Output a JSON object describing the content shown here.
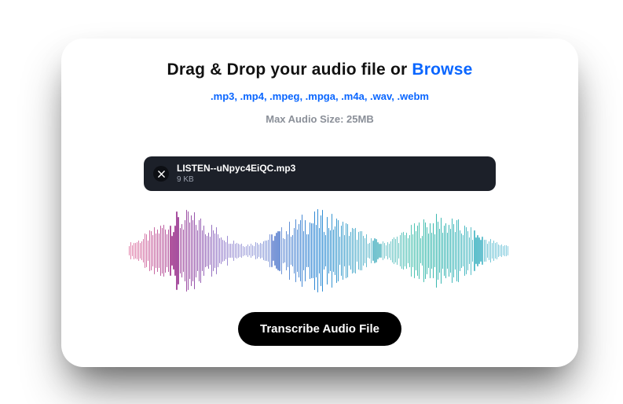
{
  "heading": {
    "prefix": "Drag & Drop your audio file or ",
    "browse": "Browse"
  },
  "formats_label": ".mp3, .mp4, .mpeg, .mpga, .m4a, .wav, .webm",
  "max_size_label": "Max Audio Size: 25MB",
  "file": {
    "name": "LISTEN--uNpyc4EiQC.mp3",
    "size": "9 KB"
  },
  "transcribe_label": "Transcribe Audio File",
  "waveform": {
    "bar_count": 240,
    "gradient": [
      "#d23a7a",
      "#7a5fbf",
      "#2f8bd6",
      "#2fb8a3",
      "#2fa7c9"
    ]
  }
}
